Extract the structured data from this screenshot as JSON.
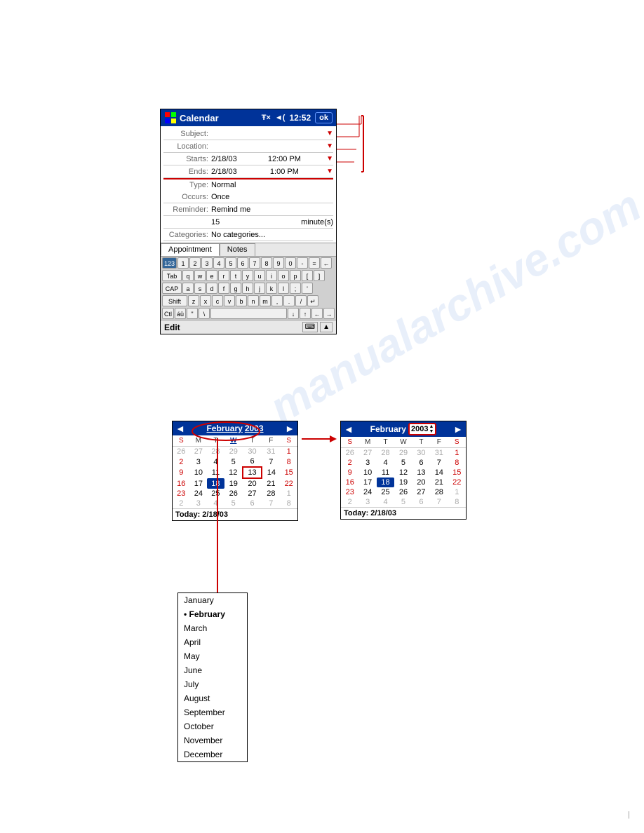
{
  "pda": {
    "title": "Calendar",
    "time": "12:52",
    "ok_label": "ok",
    "fields": {
      "subject_label": "Subject:",
      "location_label": "Location:",
      "starts_label": "Starts:",
      "starts_date": "2/18/03",
      "starts_time": "12:00 PM",
      "ends_label": "Ends:",
      "ends_date": "2/18/03",
      "ends_time": "1:00 PM",
      "type_label": "Type:",
      "type_value": "Normal",
      "occurs_label": "Occurs:",
      "occurs_value": "Once",
      "reminder_label": "Reminder:",
      "reminder_value": "Remind me",
      "reminder_duration": "15",
      "reminder_unit": "minute(s)",
      "categories_label": "Categories:",
      "categories_value": "No categories..."
    },
    "tabs": {
      "appointment": "Appointment",
      "notes": "Notes"
    },
    "bottom_bar": {
      "edit_label": "Edit"
    },
    "keyboard": {
      "rows": [
        [
          "123",
          "1",
          "2",
          "3",
          "4",
          "5",
          "6",
          "7",
          "8",
          "9",
          "0",
          "-",
          "=",
          "←"
        ],
        [
          "Tab",
          "q",
          "w",
          "e",
          "r",
          "t",
          "y",
          "u",
          "i",
          "o",
          "p",
          "[",
          "]"
        ],
        [
          "CAP",
          "a",
          "s",
          "d",
          "f",
          "g",
          "h",
          "j",
          "k",
          "l",
          ";",
          "'"
        ],
        [
          "Shift",
          "z",
          "x",
          "c",
          "v",
          "b",
          "n",
          "m",
          ",",
          ".",
          "/",
          "↵"
        ],
        [
          "Ctl",
          "áü",
          "\"",
          "\\",
          "",
          "",
          "",
          "",
          "",
          "↓",
          "↑",
          "←",
          "→"
        ]
      ]
    }
  },
  "calendar_left": {
    "month": "February",
    "year": "2003",
    "days_header": [
      "S",
      "M",
      "T",
      "W",
      "T",
      "F",
      "S"
    ],
    "weeks": [
      [
        "26",
        "27",
        "28",
        "29",
        "30",
        "31",
        "1"
      ],
      [
        "2",
        "3",
        "4",
        "5",
        "6",
        "7",
        "8"
      ],
      [
        "9",
        "10",
        "11",
        "12",
        "13",
        "14",
        "15"
      ],
      [
        "16",
        "17",
        "18",
        "19",
        "20",
        "21",
        "22"
      ],
      [
        "23",
        "24",
        "25",
        "26",
        "27",
        "28",
        "1"
      ],
      [
        "2",
        "3",
        "4",
        "5",
        "6",
        "7",
        "8"
      ]
    ],
    "dim_before": 6,
    "selected_day": "18",
    "circled_day": "13",
    "today": "Today: 2/18/03"
  },
  "calendar_right": {
    "month": "February",
    "year": "2003",
    "days_header": [
      "S",
      "M",
      "T",
      "W",
      "T",
      "F",
      "S"
    ],
    "weeks": [
      [
        "26",
        "27",
        "28",
        "29",
        "30",
        "31",
        "1"
      ],
      [
        "2",
        "3",
        "4",
        "5",
        "6",
        "7",
        "8"
      ],
      [
        "9",
        "10",
        "11",
        "12",
        "13",
        "14",
        "15"
      ],
      [
        "16",
        "17",
        "18",
        "19",
        "20",
        "21",
        "22"
      ],
      [
        "23",
        "24",
        "25",
        "26",
        "27",
        "28",
        "1"
      ],
      [
        "2",
        "3",
        "4",
        "5",
        "6",
        "7",
        "8"
      ]
    ],
    "selected_day": "18",
    "today": "Today: 2/18/03",
    "year_editable": true
  },
  "months_list": {
    "items": [
      "January",
      "February",
      "March",
      "April",
      "May",
      "June",
      "July",
      "August",
      "September",
      "October",
      "November",
      "December"
    ],
    "current": "February"
  },
  "annotations": {
    "subject_arrow": "▼",
    "location_arrow": "▼",
    "starts_arrow": "▼",
    "ends_arrow": "▼"
  }
}
